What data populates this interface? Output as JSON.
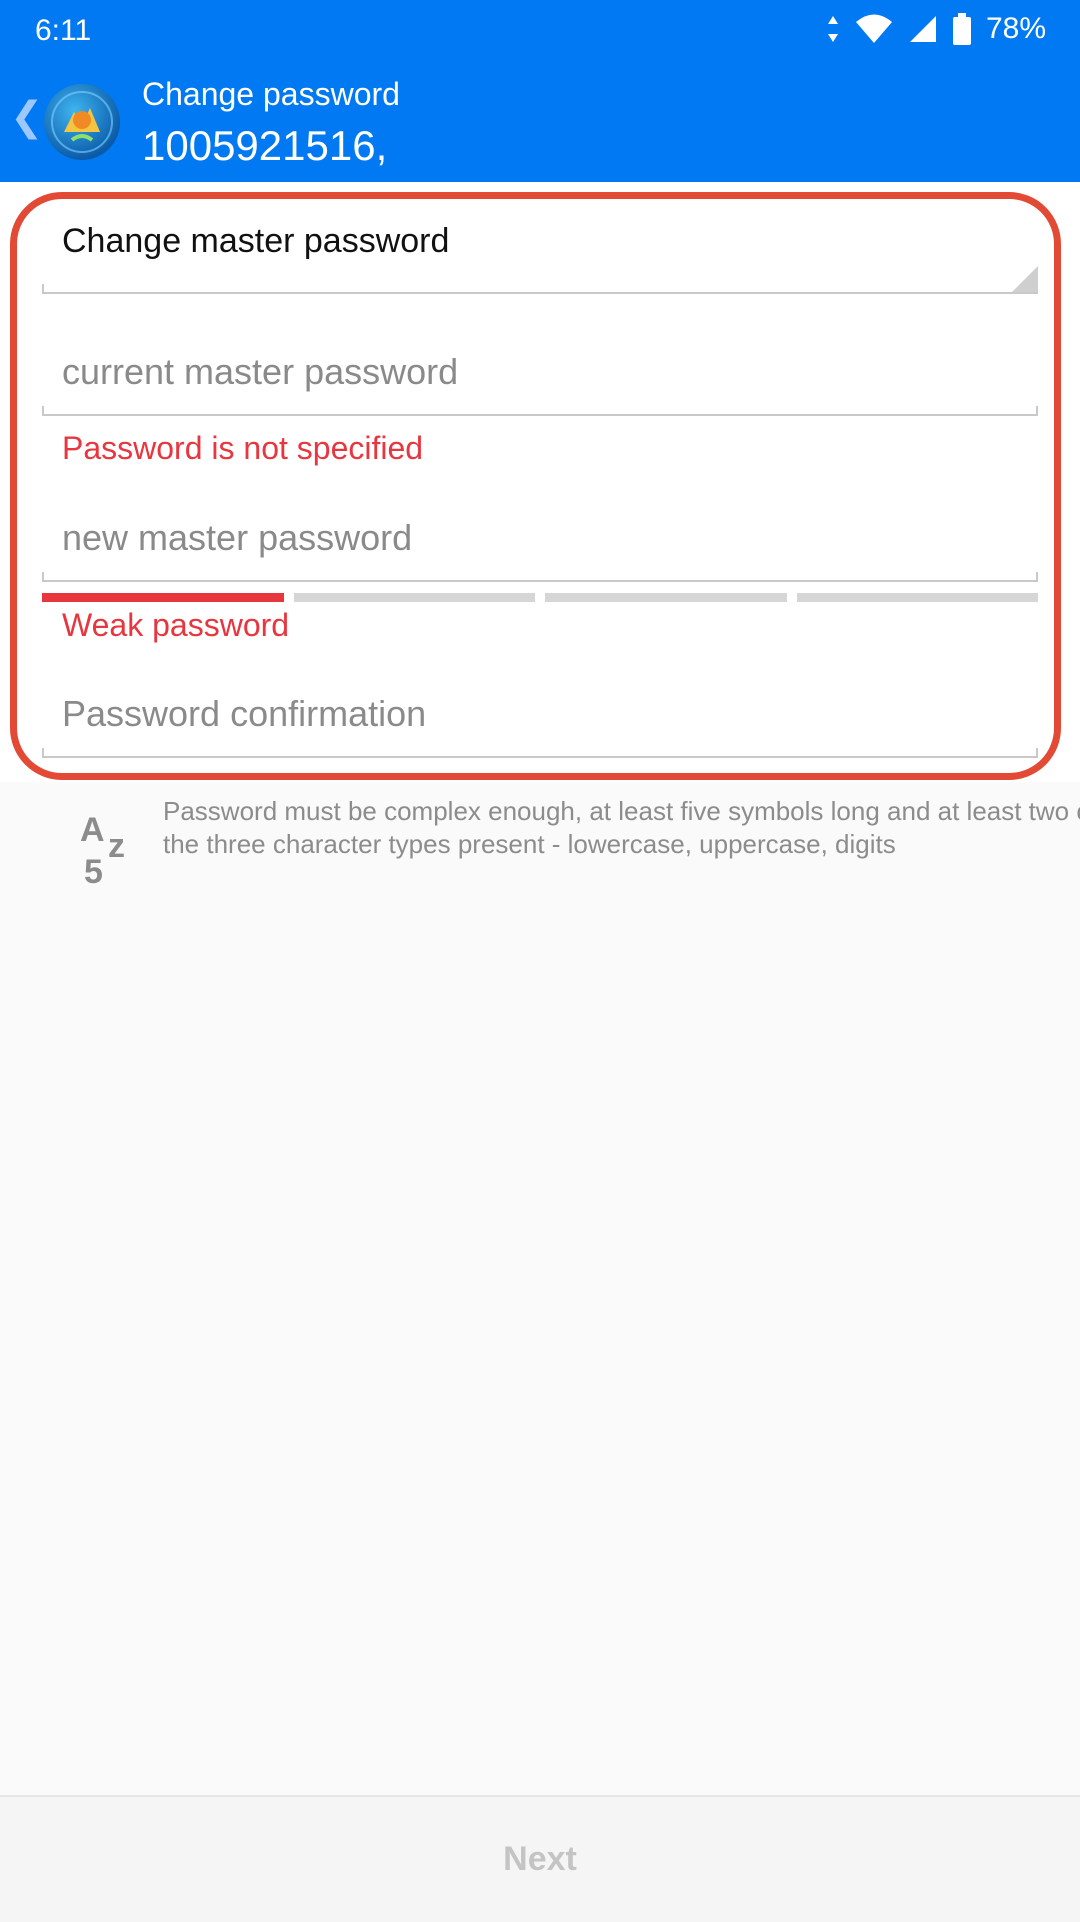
{
  "status_bar": {
    "time": "6:11",
    "battery": "78%"
  },
  "toolbar": {
    "title": "Change password",
    "account": "1005921516,"
  },
  "form": {
    "password_type": "Change master password",
    "current_placeholder": "current master password",
    "current_error": "Password is not specified",
    "new_placeholder": "new master password",
    "strength_label": "Weak password",
    "strength_level": 0.25,
    "confirm_placeholder": "Password confirmation"
  },
  "hint": {
    "icon": "a-z-5-icon",
    "icon_text": {
      "a": "A",
      "z": "z",
      "five": "5"
    },
    "text": "Password must be complex enough, at least five symbols long and at least two of the three character types present - lowercase, uppercase, digits"
  },
  "footer": {
    "next_label": "Next"
  },
  "colors": {
    "accent": "#0079f2",
    "error": "#e8363f",
    "highlight": "#e24a35"
  }
}
